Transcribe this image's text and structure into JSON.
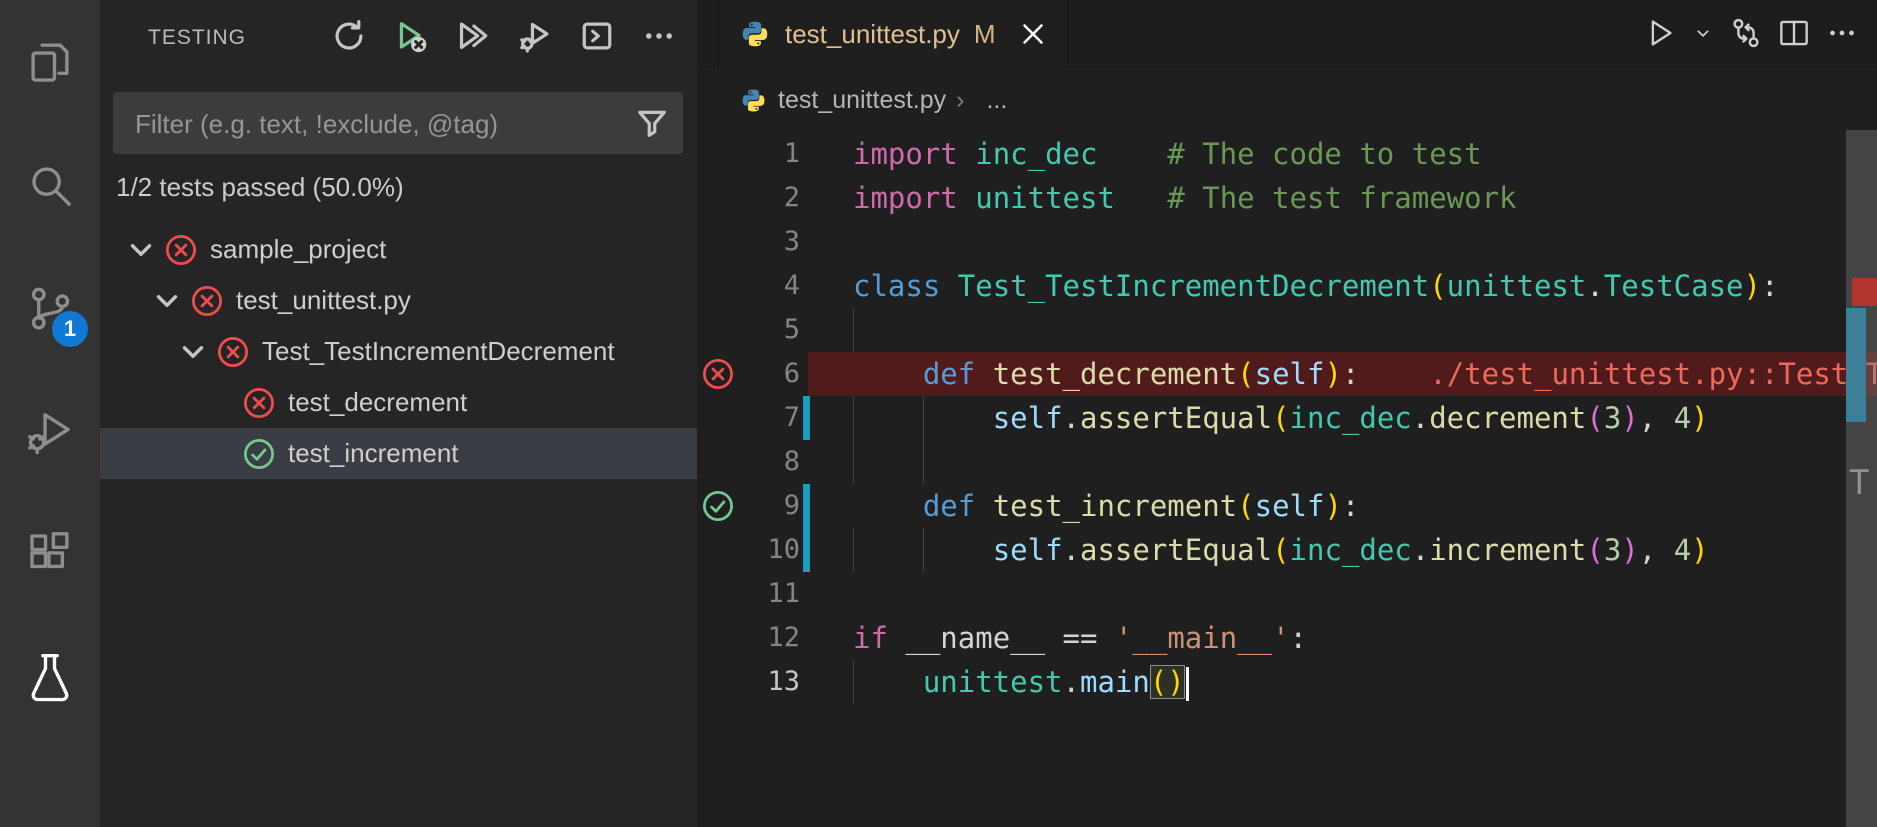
{
  "colors": {
    "fail_red": "#f14c4c",
    "pass_green": "#73c991",
    "modified_tan": "#e2c08d",
    "scm_badge_blue": "#0e7ad6",
    "change_bar_teal": "#1b9bbf",
    "error_row_bg": "#521b1b",
    "error_text": "#ea6a5c"
  },
  "activity_bar": {
    "icons": [
      "explorer-icon",
      "search-icon",
      "source-control-icon",
      "run-and-debug-icon",
      "extensions-icon",
      "testing-icon"
    ],
    "active_view": "testing",
    "source_control_badge": "1"
  },
  "sidebar": {
    "title": "TESTING",
    "toolbar_icons": [
      "refresh-tests-icon",
      "rerun-failed-tests-icon",
      "run-all-tests-icon",
      "debug-all-tests-icon",
      "show-output-icon",
      "more-actions-icon"
    ],
    "filter": {
      "placeholder": "Filter (e.g. text, !exclude, @tag)"
    },
    "status": "1/2 tests passed (50.0%)",
    "tree": [
      {
        "label": "sample_project",
        "state": "fail",
        "depth": 0,
        "expandable": true,
        "selected": false
      },
      {
        "label": "test_unittest.py",
        "state": "fail",
        "depth": 1,
        "expandable": true,
        "selected": false
      },
      {
        "label": "Test_TestIncrementDecrement",
        "state": "fail",
        "depth": 2,
        "expandable": true,
        "selected": false
      },
      {
        "label": "test_decrement",
        "state": "fail",
        "depth": 3,
        "expandable": false,
        "selected": false
      },
      {
        "label": "test_increment",
        "state": "pass",
        "depth": 3,
        "expandable": false,
        "selected": true
      }
    ]
  },
  "editor": {
    "tab": {
      "file": "test_unittest.py",
      "modified_badge": "M",
      "icon": "python"
    },
    "actions_icons": [
      "run-file-icon",
      "run-dropdown-chevron-icon",
      "open-changes-icon",
      "split-editor-icon",
      "more-actions-icon"
    ],
    "breadcrumb": {
      "file": "test_unittest.py",
      "separator": "›",
      "ellipsis": "..."
    },
    "code": {
      "lines": [
        {
          "n": 1,
          "tokens": [
            [
              "import",
              "kw"
            ],
            [
              " ",
              "pl"
            ],
            [
              "inc_dec",
              "type"
            ],
            [
              "    ",
              "pl"
            ],
            [
              "# The code to test",
              "com"
            ]
          ]
        },
        {
          "n": 2,
          "tokens": [
            [
              "import",
              "kw"
            ],
            [
              " ",
              "pl"
            ],
            [
              "unittest",
              "type"
            ],
            [
              "   ",
              "pl"
            ],
            [
              "# The test framework",
              "com"
            ]
          ]
        },
        {
          "n": 3,
          "tokens": []
        },
        {
          "n": 4,
          "tokens": [
            [
              "class",
              "bkw"
            ],
            [
              " ",
              "pl"
            ],
            [
              "Test_TestIncrementDecrement",
              "type"
            ],
            [
              "(",
              "br1"
            ],
            [
              "unittest",
              "type"
            ],
            [
              ".",
              "pl"
            ],
            [
              "TestCase",
              "type"
            ],
            [
              ")",
              "br1"
            ],
            [
              ":",
              "pl"
            ]
          ]
        },
        {
          "n": 5,
          "tokens": [],
          "guides": [
            0
          ]
        },
        {
          "n": 6,
          "tokens": [
            [
              "    ",
              "pl"
            ],
            [
              "def",
              "bkw"
            ],
            [
              " ",
              "pl"
            ],
            [
              "test_decrement",
              "fn"
            ],
            [
              "(",
              "br1"
            ],
            [
              "self",
              "self"
            ],
            [
              ")",
              "br1"
            ],
            [
              ":",
              "pl"
            ],
            [
              "    ",
              "pl"
            ],
            [
              "./test_unittest.py::Test_T",
              "err"
            ]
          ],
          "error": true,
          "icon": "fail"
        },
        {
          "n": 7,
          "tokens": [
            [
              "        ",
              "pl"
            ],
            [
              "self",
              "self"
            ],
            [
              ".",
              "pl"
            ],
            [
              "assertEqual",
              "fn"
            ],
            [
              "(",
              "br1"
            ],
            [
              "inc_dec",
              "type"
            ],
            [
              ".",
              "pl"
            ],
            [
              "decrement",
              "fn"
            ],
            [
              "(",
              "br2"
            ],
            [
              "3",
              "num"
            ],
            [
              ")",
              "br2"
            ],
            [
              ",",
              "pl"
            ],
            [
              " ",
              "pl"
            ],
            [
              "4",
              "num"
            ],
            [
              ")",
              "br1"
            ]
          ],
          "guides": [
            0,
            4
          ],
          "bar": true
        },
        {
          "n": 8,
          "tokens": [],
          "guides": [
            0,
            4
          ]
        },
        {
          "n": 9,
          "tokens": [
            [
              "    ",
              "pl"
            ],
            [
              "def",
              "bkw"
            ],
            [
              " ",
              "pl"
            ],
            [
              "test_increment",
              "fn"
            ],
            [
              "(",
              "br1"
            ],
            [
              "self",
              "self"
            ],
            [
              ")",
              "br1"
            ],
            [
              ":",
              "pl"
            ]
          ],
          "icon": "pass",
          "bar": true
        },
        {
          "n": 10,
          "tokens": [
            [
              "        ",
              "pl"
            ],
            [
              "self",
              "self"
            ],
            [
              ".",
              "pl"
            ],
            [
              "assertEqual",
              "fn"
            ],
            [
              "(",
              "br1"
            ],
            [
              "inc_dec",
              "type"
            ],
            [
              ".",
              "pl"
            ],
            [
              "increment",
              "fn"
            ],
            [
              "(",
              "br2"
            ],
            [
              "3",
              "num"
            ],
            [
              ")",
              "br2"
            ],
            [
              ",",
              "pl"
            ],
            [
              " ",
              "pl"
            ],
            [
              "4",
              "num"
            ],
            [
              ")",
              "br1"
            ]
          ],
          "guides": [
            0,
            4
          ],
          "bar": true
        },
        {
          "n": 11,
          "tokens": []
        },
        {
          "n": 12,
          "tokens": [
            [
              "if",
              "kw"
            ],
            [
              " ",
              "pl"
            ],
            [
              "__name__",
              "dunder"
            ],
            [
              " ",
              "pl"
            ],
            [
              "==",
              "pl"
            ],
            [
              " ",
              "pl"
            ],
            [
              "'__main__'",
              "str"
            ],
            [
              ":",
              "pl"
            ]
          ]
        },
        {
          "n": 13,
          "tokens": [
            [
              "    ",
              "pl"
            ],
            [
              "unittest",
              "type"
            ],
            [
              ".",
              "pl"
            ],
            [
              "main",
              "self"
            ],
            [
              "()",
              "brmatch"
            ]
          ],
          "guides": [
            0
          ],
          "active": true,
          "cursor": true
        }
      ]
    },
    "minimap": {
      "markers": [
        "error-marker",
        "changes-marker",
        "text-artifact"
      ]
    }
  }
}
